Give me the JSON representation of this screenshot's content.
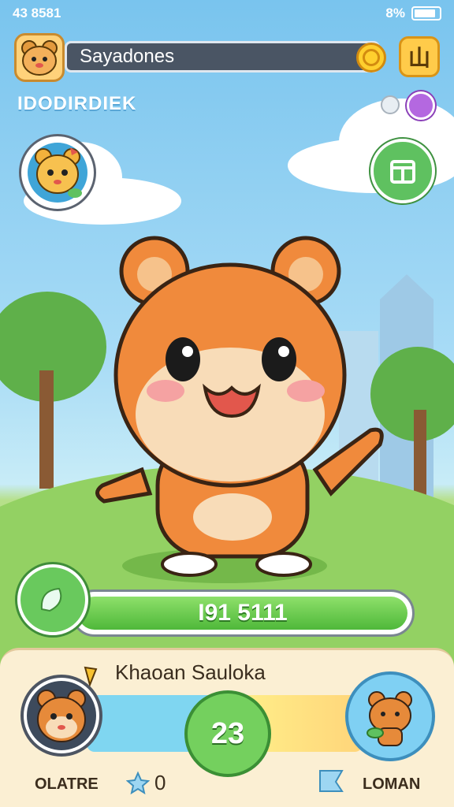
{
  "status_bar": {
    "signal": "43 8581",
    "battery": "8%"
  },
  "header": {
    "player_name": "Sayadones",
    "menu_label": "山"
  },
  "subtitle": "IDODIRDIEK",
  "progress": {
    "value_text": "I91 5111",
    "fill_fraction": 1.0
  },
  "panel": {
    "title": "Khaoan Sauloka",
    "center_value": "23",
    "left_label": "OLATRE",
    "right_label": "LOMAN",
    "count": "0"
  },
  "colors": {
    "accent": "#5fc160",
    "bear": "#f08a3c"
  },
  "icons": [
    "hamster-avatar-icon",
    "coin-icon",
    "menu-icon",
    "gem-icon",
    "profile-girl-icon",
    "shop-icon",
    "leaf-icon",
    "star-icon",
    "flag-icon"
  ]
}
